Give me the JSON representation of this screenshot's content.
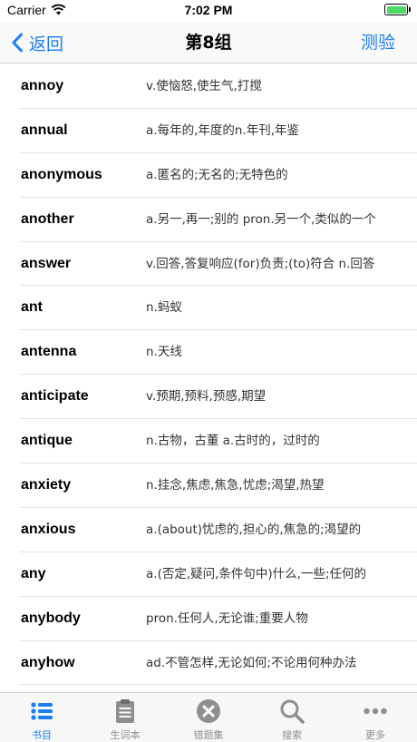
{
  "status_bar": {
    "carrier": "Carrier",
    "time": "7:02 PM"
  },
  "nav": {
    "back_label": "返回",
    "title": "第8组",
    "test_label": "测验"
  },
  "words": [
    {
      "term": "annoy",
      "definition": "v.使恼怒,使生气,打搅"
    },
    {
      "term": "annual",
      "definition": "a.每年的,年度的n.年刊,年鉴"
    },
    {
      "term": "anonymous",
      "definition": "a.匿名的;无名的;无特色的"
    },
    {
      "term": "another",
      "definition": "a.另一,再一;别的 pron.另一个,类似的一个"
    },
    {
      "term": "answer",
      "definition": "v.回答,答复响应(for)负责;(to)符合 n.回答"
    },
    {
      "term": "ant",
      "definition": "n.蚂蚁"
    },
    {
      "term": "antenna",
      "definition": "n.天线"
    },
    {
      "term": "anticipate",
      "definition": "v.预期,预料,预感,期望"
    },
    {
      "term": "antique",
      "definition": "n.古物，古董 a.古时的，过时的"
    },
    {
      "term": "anxiety",
      "definition": "n.挂念,焦虑,焦急,忧虑;渴望,热望"
    },
    {
      "term": "anxious",
      "definition": "a.(about)忧虑的,担心的,焦急的;渴望的"
    },
    {
      "term": "any",
      "definition": "a.(否定,疑问,条件句中)什么,一些;任何的"
    },
    {
      "term": "anybody",
      "definition": "pron.任何人,无论谁;重要人物"
    },
    {
      "term": "anyhow",
      "definition": "ad.不管怎样,无论如何;不论用何种办法"
    }
  ],
  "tabs": [
    {
      "label": "书目",
      "icon": "list-icon",
      "active": true
    },
    {
      "label": "生词本",
      "icon": "clipboard-icon",
      "active": false
    },
    {
      "label": "错题集",
      "icon": "close-circle-icon",
      "active": false
    },
    {
      "label": "搜索",
      "icon": "search-icon",
      "active": false
    },
    {
      "label": "更多",
      "icon": "more-icon",
      "active": false
    }
  ],
  "colors": {
    "accent": "#1a7ef7",
    "inactive": "#8e8e93",
    "battery": "#4cd964"
  }
}
